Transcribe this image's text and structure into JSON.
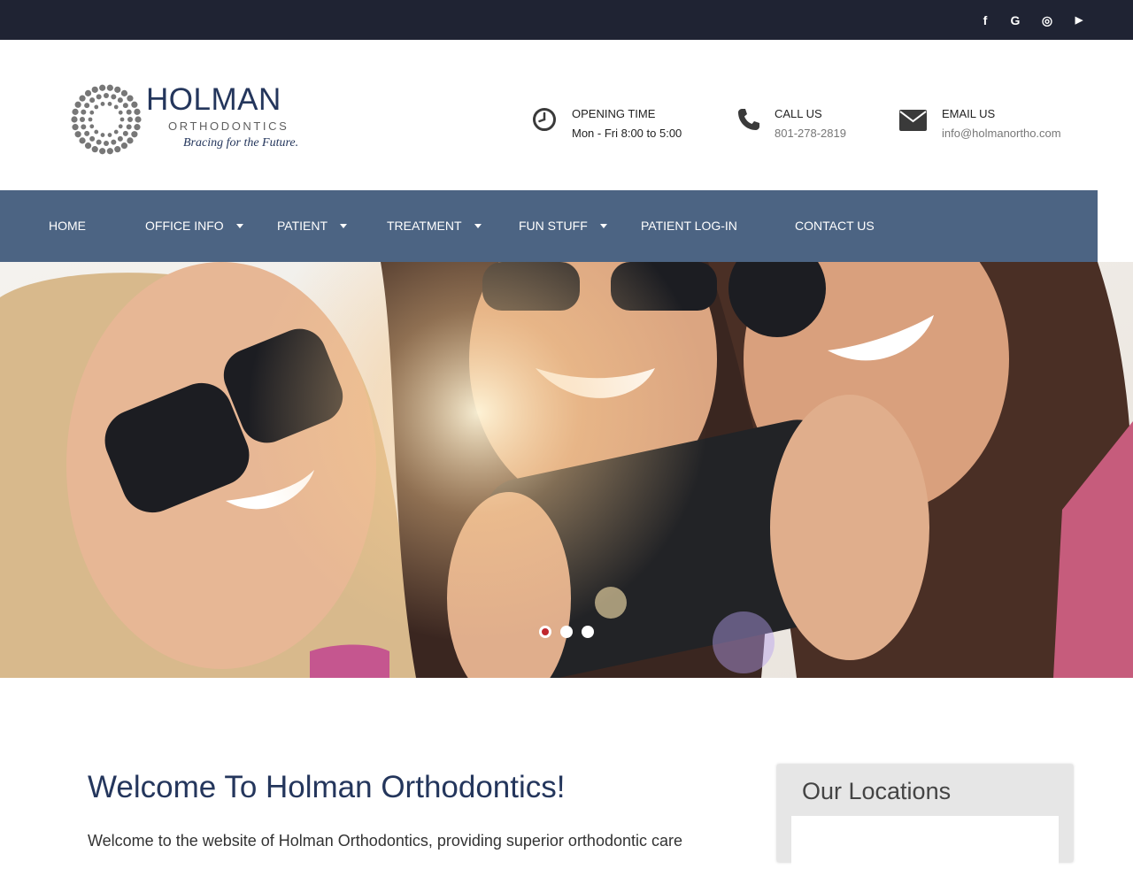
{
  "topbar": {
    "social": [
      {
        "icon": "facebook-icon",
        "glyph": "f"
      },
      {
        "icon": "google-icon",
        "glyph": "G"
      },
      {
        "icon": "instagram-icon",
        "glyph": "◎"
      },
      {
        "icon": "youtube-icon",
        "glyph": "▶"
      }
    ]
  },
  "logo": {
    "name": "HOLMAN",
    "sub": "ORTHODONTICS",
    "tagline": "Bracing for the Future."
  },
  "contact": {
    "hours": {
      "icon": "clock-icon",
      "title": "OPENING TIME",
      "value": "Mon - Fri 8:00 to 5:00"
    },
    "phone": {
      "icon": "phone-icon",
      "title": "CALL US",
      "value": "801-278-2819"
    },
    "email": {
      "icon": "envelope-icon",
      "title": "EMAIL US",
      "value": "info@holmanortho.com"
    }
  },
  "nav": {
    "items": [
      {
        "label": "HOME",
        "dropdown": false
      },
      {
        "label": "OFFICE INFO",
        "dropdown": true
      },
      {
        "label": "PATIENT",
        "dropdown": true
      },
      {
        "label": "TREATMENT",
        "dropdown": true
      },
      {
        "label": "FUN STUFF",
        "dropdown": true
      },
      {
        "label": "PATIENT LOG-IN",
        "dropdown": false
      },
      {
        "label": "CONTACT US",
        "dropdown": false
      }
    ]
  },
  "slider": {
    "slide_count": 3,
    "active_slide": 1
  },
  "welcome": {
    "title": "Welcome To Holman Orthodontics!",
    "text": "Welcome to the website of Holman Orthodontics, providing superior orthodontic care"
  },
  "locations": {
    "title": "Our Locations"
  },
  "colors": {
    "topbar": "#1f2333",
    "nav": "#4c6483",
    "brand_navy": "#24365c",
    "active_dot": "#c0272d"
  }
}
